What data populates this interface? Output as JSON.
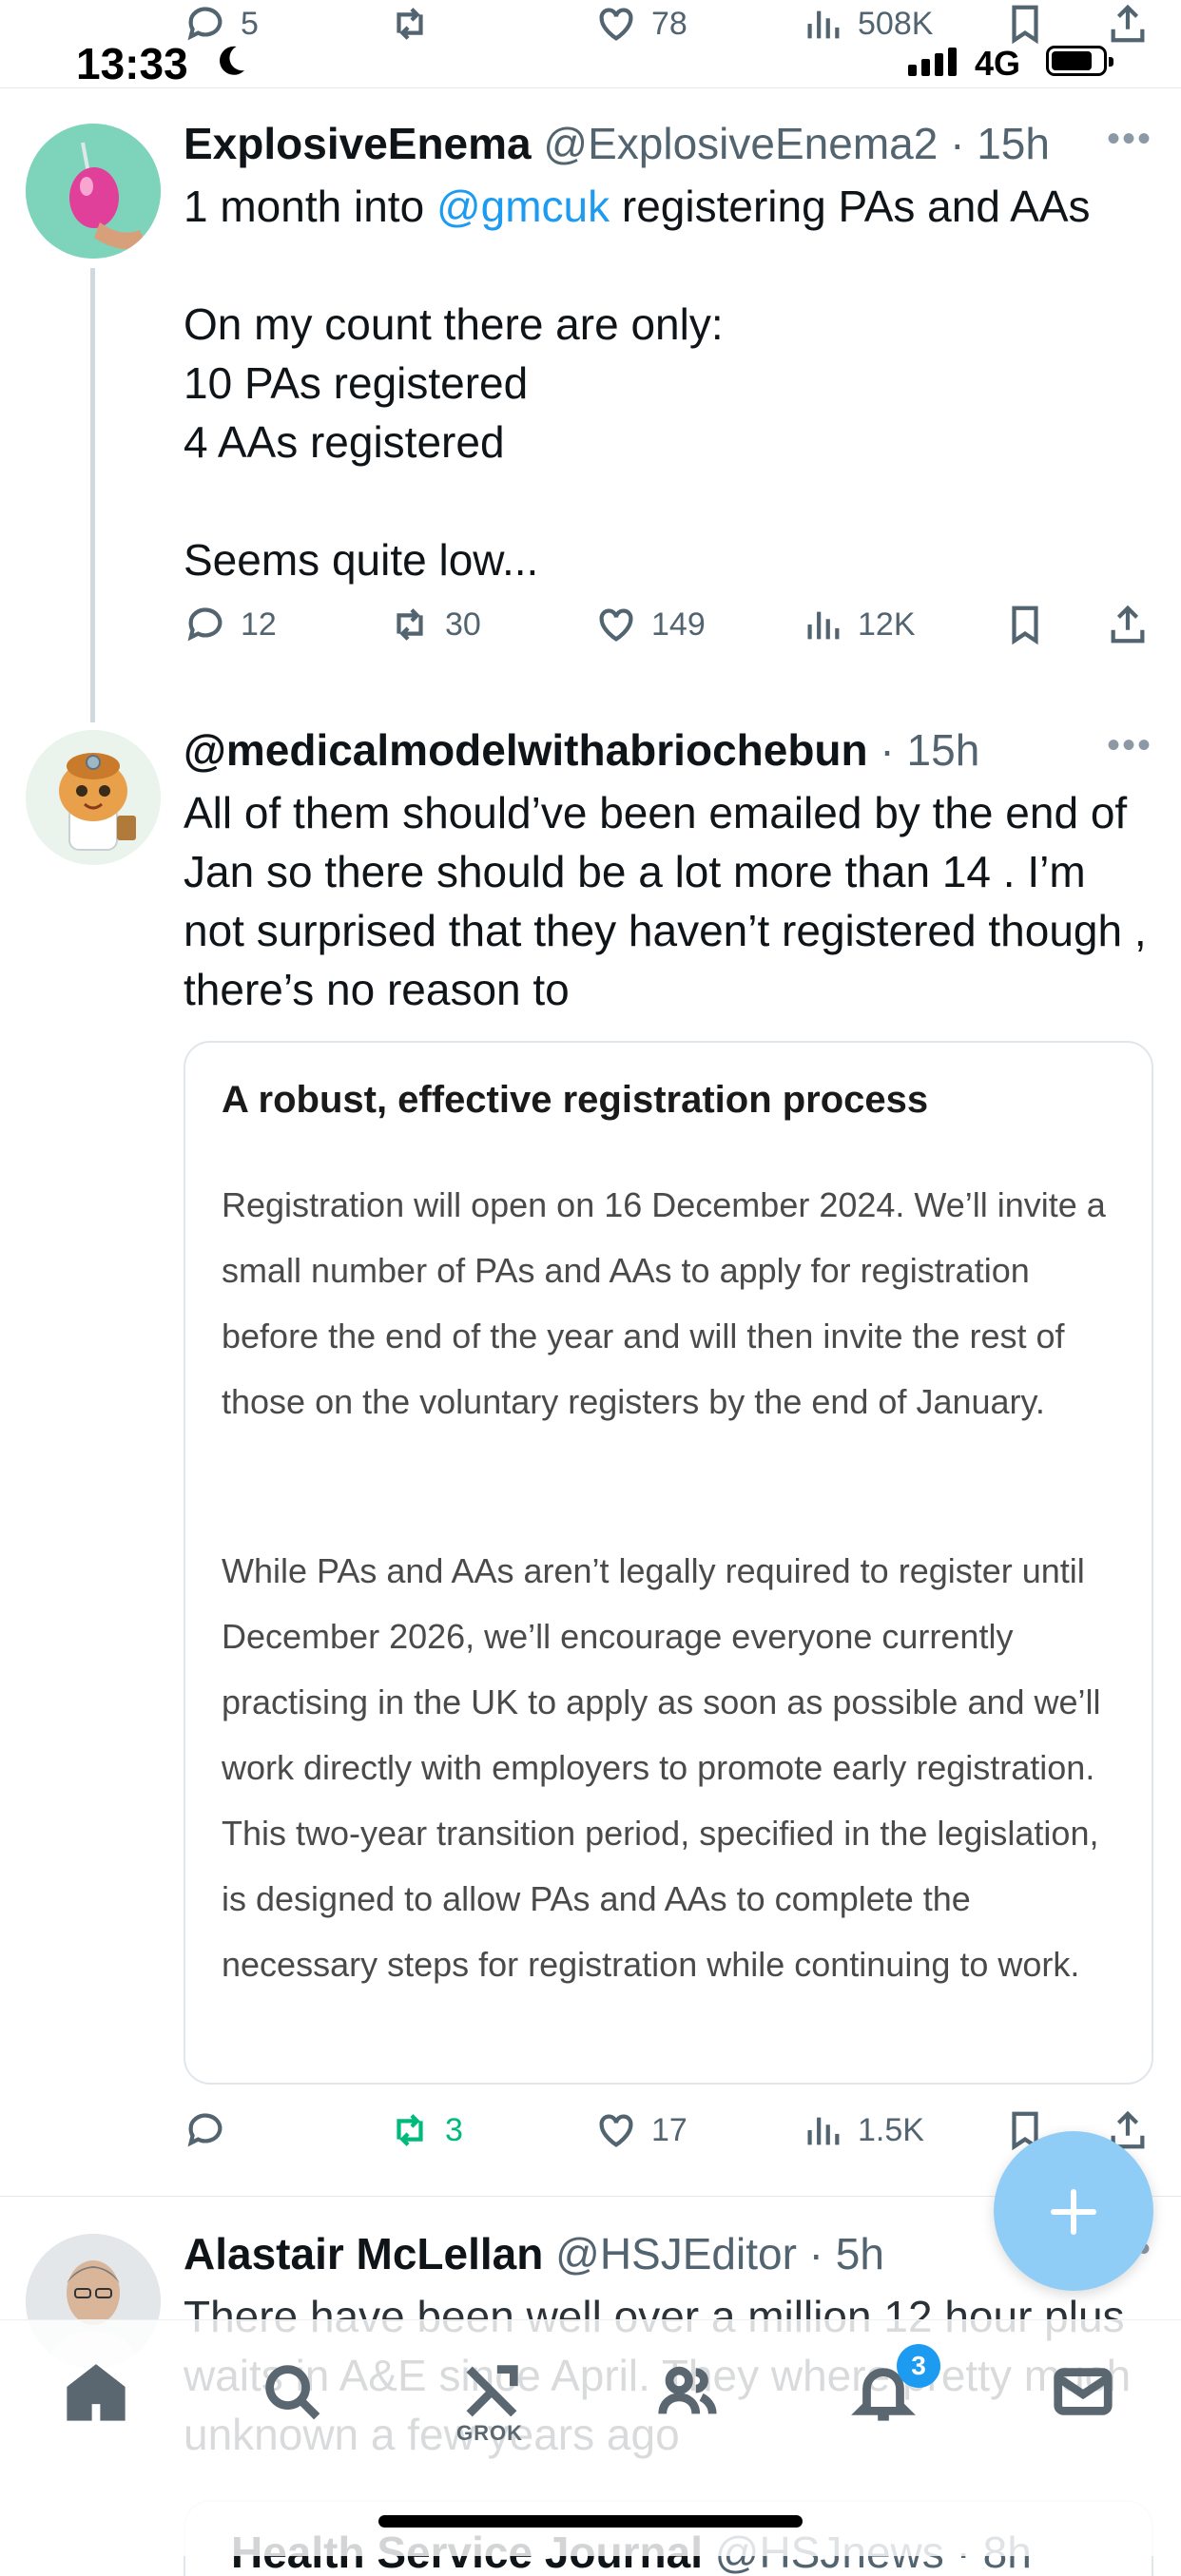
{
  "status_bar": {
    "time": "13:33",
    "network": "4G"
  },
  "top_actions": {
    "replies": "5",
    "views": "508K",
    "likes": "78"
  },
  "tweets": [
    {
      "name": "ExplosiveEnema",
      "handle": "@ExplosiveEnema2",
      "time": "15h",
      "text_pre": "1 month into ",
      "mention": "@gmcuk",
      "text_post": " registering PAs and AAs",
      "lines": [
        "On my count there are only:",
        "10 PAs registered",
        "4 AAs registered",
        "Seems quite low..."
      ],
      "replies": "12",
      "retweets": "30",
      "likes": "149",
      "views": "12K"
    },
    {
      "name": "@medicalmodelwithabriochebun",
      "time": "15h",
      "text": "All of them should’ve been emailed by the end of Jan so there should be a lot more than 14 . I’m not surprised that they haven’t registered though , there’s no reason to",
      "quote": {
        "title": "A robust, effective registration process",
        "para1": "Registration will open on 16 December 2024. We’ll invite a small number of PAs and AAs to apply for registration before the end of the year and will then invite the rest of those on the voluntary registers by the end of January.",
        "para2": "While PAs and AAs aren’t legally required to register until December 2026, we’ll encourage everyone currently practising in the UK to apply as soon as possible and we’ll work directly with employers to promote early registration. This two-year transition period, specified in the legislation, is designed to allow PAs and AAs to complete the necessary steps for registration while continuing to work."
      },
      "retweets": "3",
      "likes": "17",
      "views": "1.5K"
    },
    {
      "name": "Alastair McLellan",
      "handle": "@HSJEditor",
      "time": "5h",
      "text": "There have been well over a million 12 hour plus waits in A&E since April. They where pretty much unknown a few years ago",
      "quote_partial": {
        "name": "Health Service Journal",
        "handle": "@HSJnews",
        "time": "8h"
      }
    }
  ],
  "bottom_nav": {
    "grok_label": "GROK",
    "notifications_badge": "3"
  },
  "colors": {
    "accent": "#1d9bf0",
    "retweet_active": "#00ba7c",
    "fab": "#8fcdf7"
  }
}
